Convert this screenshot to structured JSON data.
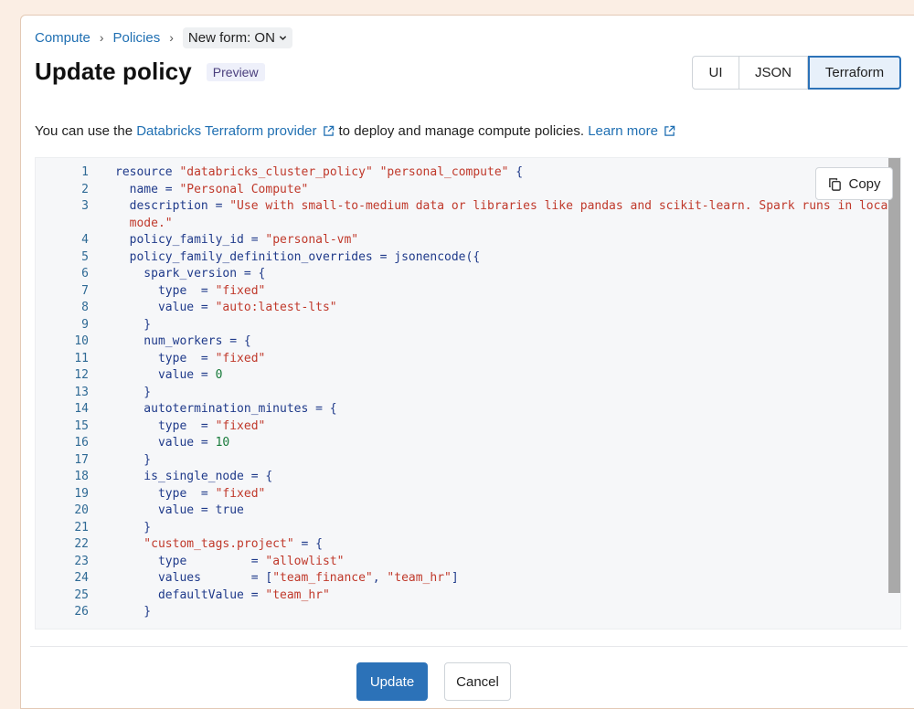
{
  "breadcrumb": {
    "items": [
      "Compute",
      "Policies"
    ],
    "new_form": "New form: ON"
  },
  "title": "Update policy",
  "badge": "Preview",
  "tabs": [
    "UI",
    "JSON",
    "Terraform"
  ],
  "description": {
    "before": "You can use the",
    "link1": "Databricks Terraform provider",
    "middle": "to deploy and manage compute policies.",
    "link2": "Learn more"
  },
  "copy_label": "Copy",
  "code_lines": [
    {
      "n": "1",
      "parts": [
        [
          "kw",
          "resource "
        ],
        [
          "str",
          "\"databricks_cluster_policy\" \"personal_compute\""
        ],
        [
          "kw",
          " {"
        ]
      ]
    },
    {
      "n": "2",
      "parts": [
        [
          "kw",
          "  name = "
        ],
        [
          "str",
          "\"Personal Compute\""
        ]
      ]
    },
    {
      "n": "3",
      "parts": [
        [
          "kw",
          "  description = "
        ],
        [
          "str",
          "\"Use with small-to-medium data or libraries like pandas and scikit-learn. Spark runs in local"
        ]
      ]
    },
    {
      "n": "",
      "parts": [
        [
          "str",
          "  mode.\""
        ]
      ]
    },
    {
      "n": "4",
      "parts": [
        [
          "kw",
          "  policy_family_id = "
        ],
        [
          "str",
          "\"personal-vm\""
        ]
      ]
    },
    {
      "n": "5",
      "parts": [
        [
          "kw",
          "  policy_family_definition_overrides = jsonencode({"
        ]
      ]
    },
    {
      "n": "6",
      "parts": [
        [
          "kw",
          "    spark_version = {"
        ]
      ]
    },
    {
      "n": "7",
      "parts": [
        [
          "kw",
          "      type  = "
        ],
        [
          "str",
          "\"fixed\""
        ]
      ]
    },
    {
      "n": "8",
      "parts": [
        [
          "kw",
          "      value = "
        ],
        [
          "str",
          "\"auto:latest-lts\""
        ]
      ]
    },
    {
      "n": "9",
      "parts": [
        [
          "kw",
          "    }"
        ]
      ]
    },
    {
      "n": "10",
      "parts": [
        [
          "kw",
          "    num_workers = {"
        ]
      ]
    },
    {
      "n": "11",
      "parts": [
        [
          "kw",
          "      type  = "
        ],
        [
          "str",
          "\"fixed\""
        ]
      ]
    },
    {
      "n": "12",
      "parts": [
        [
          "kw",
          "      value = "
        ],
        [
          "num",
          "0"
        ]
      ]
    },
    {
      "n": "13",
      "parts": [
        [
          "kw",
          "    }"
        ]
      ]
    },
    {
      "n": "14",
      "parts": [
        [
          "kw",
          "    autotermination_minutes = {"
        ]
      ]
    },
    {
      "n": "15",
      "parts": [
        [
          "kw",
          "      type  = "
        ],
        [
          "str",
          "\"fixed\""
        ]
      ]
    },
    {
      "n": "16",
      "parts": [
        [
          "kw",
          "      value = "
        ],
        [
          "num",
          "10"
        ]
      ]
    },
    {
      "n": "17",
      "parts": [
        [
          "kw",
          "    }"
        ]
      ]
    },
    {
      "n": "18",
      "parts": [
        [
          "kw",
          "    is_single_node = {"
        ]
      ]
    },
    {
      "n": "19",
      "parts": [
        [
          "kw",
          "      type  = "
        ],
        [
          "str",
          "\"fixed\""
        ]
      ]
    },
    {
      "n": "20",
      "parts": [
        [
          "kw",
          "      value = true"
        ]
      ]
    },
    {
      "n": "21",
      "parts": [
        [
          "kw",
          "    }"
        ]
      ]
    },
    {
      "n": "22",
      "parts": [
        [
          "str",
          "    \"custom_tags.project\""
        ],
        [
          "kw",
          " = {"
        ]
      ]
    },
    {
      "n": "23",
      "parts": [
        [
          "kw",
          "      type         = "
        ],
        [
          "str",
          "\"allowlist\""
        ]
      ]
    },
    {
      "n": "24",
      "parts": [
        [
          "kw",
          "      values       = ["
        ],
        [
          "str",
          "\"team_finance\""
        ],
        [
          "kw",
          ", "
        ],
        [
          "str",
          "\"team_hr\""
        ],
        [
          "kw",
          "]"
        ]
      ]
    },
    {
      "n": "25",
      "parts": [
        [
          "kw",
          "      defaultValue = "
        ],
        [
          "str",
          "\"team_hr\""
        ]
      ]
    },
    {
      "n": "26",
      "parts": [
        [
          "kw",
          "    }"
        ]
      ]
    }
  ],
  "buttons": {
    "update": "Update",
    "cancel": "Cancel"
  },
  "colors": {
    "accent": "#2c72b8",
    "link": "#1f6fb2",
    "string": "#c0392b",
    "number": "#177a3a"
  }
}
